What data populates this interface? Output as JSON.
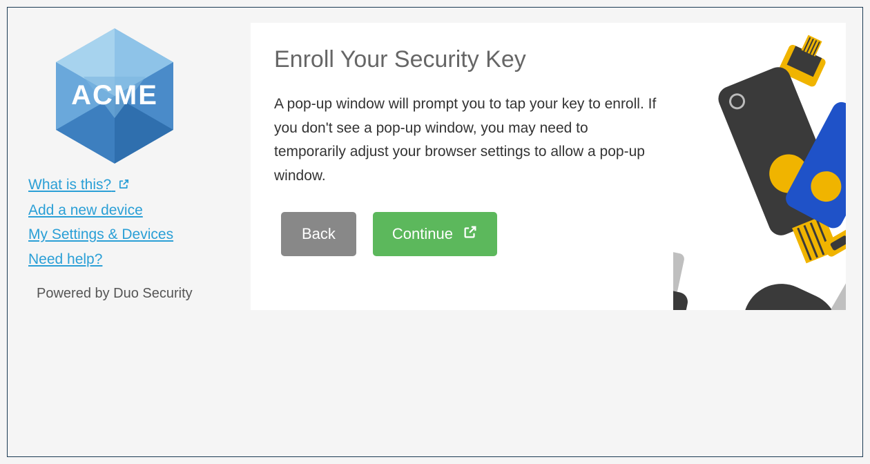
{
  "brand": {
    "name": "ACME"
  },
  "sidebar": {
    "links": [
      {
        "label": "What is this?",
        "external": true
      },
      {
        "label": "Add a new device",
        "external": false
      },
      {
        "label": "My Settings & Devices",
        "external": false
      },
      {
        "label": "Need help?",
        "external": false
      }
    ],
    "powered_by": "Powered by Duo Security"
  },
  "panel": {
    "title": "Enroll Your Security Key",
    "body": "A pop-up window will prompt you to tap your key to enroll. If you don't see a pop-up window, you may need to temporarily adjust your browser settings to allow a pop-up window.",
    "back_label": "Back",
    "continue_label": "Continue"
  }
}
